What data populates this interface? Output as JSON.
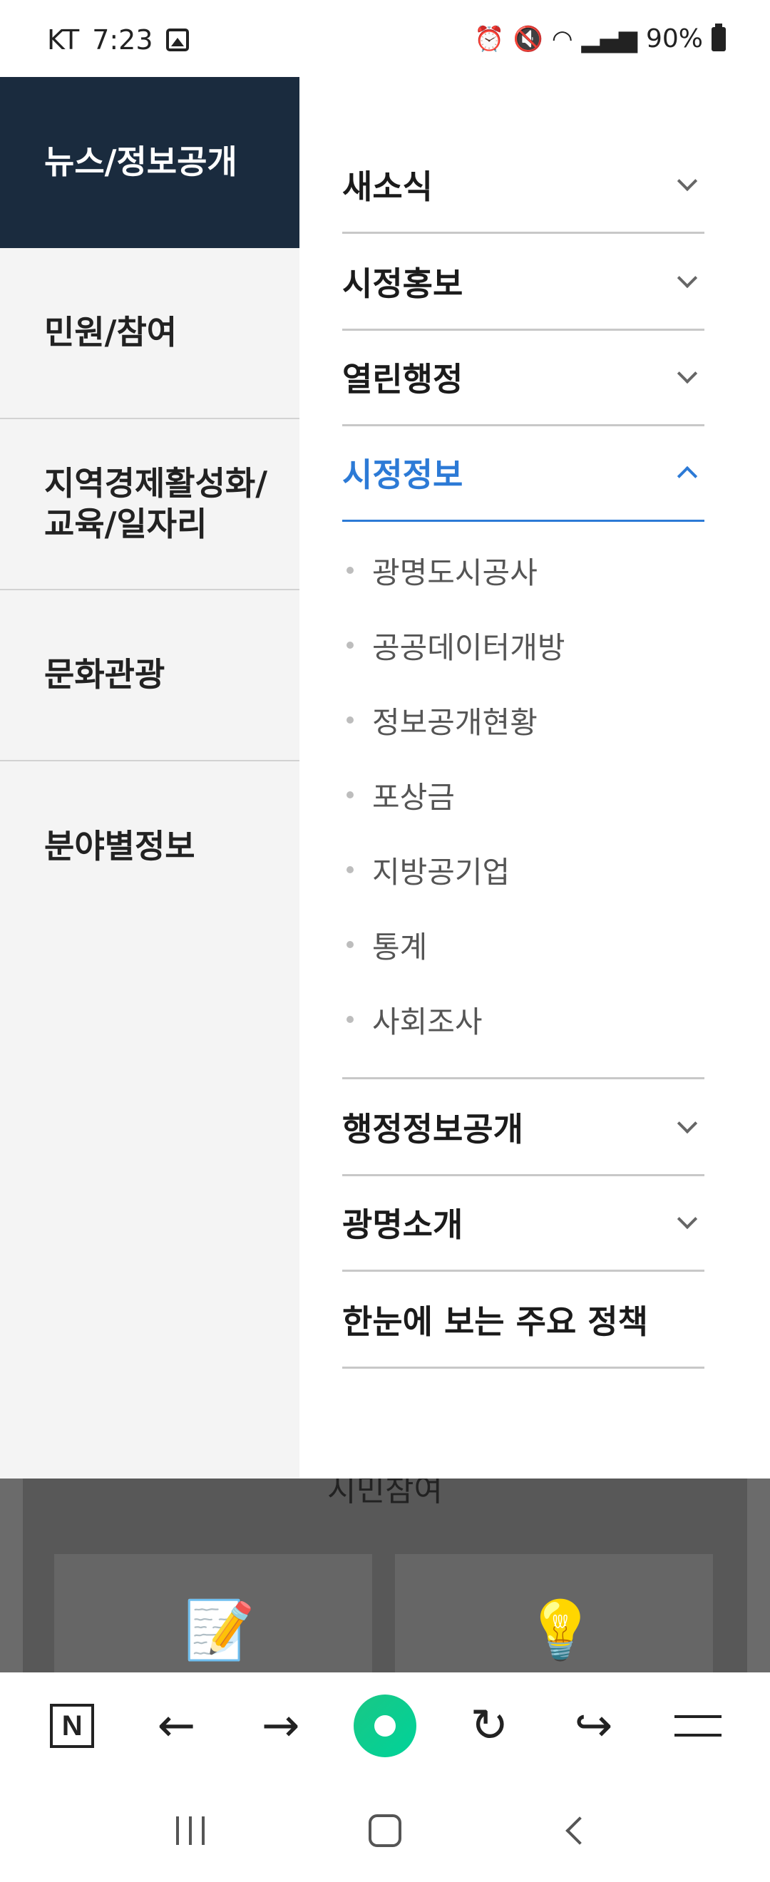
{
  "status_bar": {
    "carrier": "KT",
    "time": "7:23",
    "battery": "90%"
  },
  "left_menu": {
    "items": [
      {
        "label": "뉴스/정보공개",
        "active": true
      },
      {
        "label": "민원/참여",
        "active": false
      },
      {
        "label": "지역경제활성화/\n교육/일자리",
        "active": false
      },
      {
        "label": "문화관광",
        "active": false
      },
      {
        "label": "분야별정보",
        "active": false
      }
    ]
  },
  "right_menu": {
    "items": [
      {
        "label": "새소식",
        "expanded": false
      },
      {
        "label": "시정홍보",
        "expanded": false
      },
      {
        "label": "열린행정",
        "expanded": false
      },
      {
        "label": "시정정보",
        "expanded": true
      },
      {
        "label": "행정정보공개",
        "expanded": false
      },
      {
        "label": "광명소개",
        "expanded": false
      },
      {
        "label": "한눈에 보는 주요 정책",
        "expanded": false
      }
    ],
    "sub_items": [
      "광명도시공사",
      "공공데이터개방",
      "정보공개현황",
      "포상금",
      "지방공기업",
      "통계",
      "사회조사"
    ]
  },
  "background_page": {
    "section_title": "시민참여"
  },
  "browser_toolbar": {
    "n_label": "N"
  },
  "colors": {
    "active_category_bg": "#1a2b3e",
    "accent_blue": "#2c7ad6",
    "home_green": "#19c785"
  }
}
